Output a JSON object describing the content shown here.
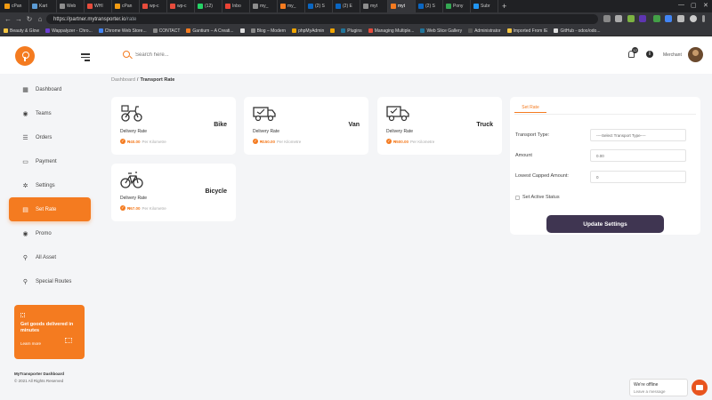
{
  "browser": {
    "tabs": [
      {
        "label": "cPan",
        "color": "#f39c12"
      },
      {
        "label": "Kart",
        "color": "#5b9bd5"
      },
      {
        "label": "Web",
        "color": "#8e8e8e"
      },
      {
        "label": "WHI",
        "color": "#e74c3c"
      },
      {
        "label": "cPan",
        "color": "#f39c12"
      },
      {
        "label": "wp-c",
        "color": "#e74c3c"
      },
      {
        "label": "wp-c",
        "color": "#e74c3c"
      },
      {
        "label": "(12)",
        "color": "#25d366"
      },
      {
        "label": "Inbo",
        "color": "#ea4335"
      },
      {
        "label": "my_",
        "color": "#8e8e8e"
      },
      {
        "label": "my_",
        "color": "#f47b20"
      },
      {
        "label": "(2) S",
        "color": "#0a66c2"
      },
      {
        "label": "(2) E",
        "color": "#0a66c2"
      },
      {
        "label": "myt",
        "color": "#8e8e8e"
      },
      {
        "label": "myt",
        "color": "#f47b20"
      },
      {
        "label": "(2) S",
        "color": "#0a66c2"
      },
      {
        "label": "Pony",
        "color": "#34a853"
      },
      {
        "label": "Subr",
        "color": "#2196f3"
      }
    ],
    "active_tab": 14,
    "url_host": "https://partner.mytransporter.io",
    "url_path": "/rate",
    "bookmarks": [
      {
        "label": "Beauty & Glow",
        "color": "#f4c542"
      },
      {
        "label": "Wappalyzer - Chro...",
        "color": "#6c3fd1"
      },
      {
        "label": "Chrome Web Store...",
        "color": "#4285f4"
      },
      {
        "label": "CONTACT",
        "color": "#888888"
      },
      {
        "label": "Gantium – A Creati...",
        "color": "#f47b20"
      },
      {
        "label": "",
        "color": "#dddddd"
      },
      {
        "label": "Blog – Modern",
        "color": "#888888"
      },
      {
        "label": "phpMyAdmin",
        "color": "#f0a500"
      },
      {
        "label": "",
        "color": "#f0a500"
      },
      {
        "label": "Plugins",
        "color": "#21759b"
      },
      {
        "label": "Managing Multiple...",
        "color": "#e74c3c"
      },
      {
        "label": "Web Slice Gallery",
        "color": "#21759b"
      },
      {
        "label": "Administrator",
        "color": "#555555"
      },
      {
        "label": "Imported From IE",
        "color": "#f4c542"
      },
      {
        "label": "GitHub - odoo/odo...",
        "color": "#dddddd"
      }
    ]
  },
  "header": {
    "search_placeholder": "Search here...",
    "notification_count": "12",
    "user_role": "Merchant"
  },
  "sidebar": {
    "items": [
      {
        "label": "Dashboard",
        "icon": "dashboard-icon",
        "glyph": "▦"
      },
      {
        "label": "Teams",
        "icon": "teams-icon",
        "glyph": "◉"
      },
      {
        "label": "Orders",
        "icon": "orders-icon",
        "glyph": "☰"
      },
      {
        "label": "Payment",
        "icon": "payment-icon",
        "glyph": "▭"
      },
      {
        "label": "Settings",
        "icon": "settings-icon",
        "glyph": "✲"
      },
      {
        "label": "Set Rate",
        "icon": "set-rate-icon",
        "glyph": "▤"
      },
      {
        "label": "Promo",
        "icon": "promo-icon",
        "glyph": "◉"
      },
      {
        "label": "All Asset",
        "icon": "asset-icon",
        "glyph": "⚲"
      },
      {
        "label": "Special Routes",
        "icon": "route-icon",
        "glyph": "⚲"
      }
    ],
    "active_index": 5,
    "promo": {
      "title": "Get goods delivered in minutes",
      "link": "Learn more"
    },
    "footer": {
      "name": "MyTransporter Dashboard",
      "copyright": "© 2021 All Rights Reserved"
    }
  },
  "breadcrumb": {
    "parent": "Dashboard",
    "separator": "/",
    "current": "Transport Rate"
  },
  "rates": [
    {
      "vehicle": "Bike",
      "label": "Delivery Rate",
      "price": "₦40.00",
      "unit": "Per Kilometre",
      "icon": "bike-icon"
    },
    {
      "vehicle": "Van",
      "label": "Delivery Rate",
      "price": "₦150.00",
      "unit": "Per Kilometre",
      "icon": "van-icon"
    },
    {
      "vehicle": "Truck",
      "label": "Delivery Rate",
      "price": "₦500.00",
      "unit": "Per Kilometre",
      "icon": "truck-icon"
    },
    {
      "vehicle": "Bicycle",
      "label": "Delivery Rate",
      "price": "₦67.00",
      "unit": "Per Kilometre",
      "icon": "bicycle-icon"
    }
  ],
  "form": {
    "tab": "Set Rate",
    "transport_type_label": "Transport Type:",
    "transport_type_value": "----Select Transport Type----",
    "amount_label": "Amount",
    "amount_value": "0.00",
    "lowest_label": "Lowest Capped Amount:",
    "lowest_value": "0",
    "active_label": "Set Active Status",
    "submit": "Update Settings"
  },
  "chat": {
    "title": "We're offline",
    "subtitle": "Leave a message"
  },
  "colors": {
    "accent": "#f47b20",
    "button_dark": "#3f3551"
  }
}
